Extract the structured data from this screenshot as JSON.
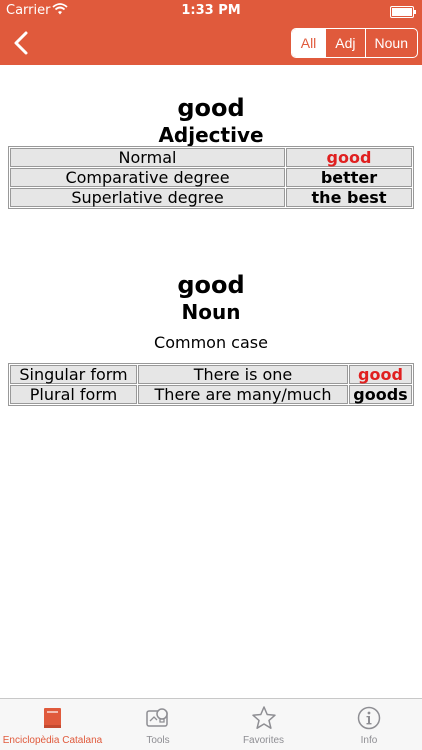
{
  "status_bar": {
    "carrier": "Carrier",
    "time": "1:33 PM"
  },
  "nav": {
    "filters": [
      "All",
      "Adj",
      "Noun"
    ],
    "active_filter": "All"
  },
  "adjective": {
    "word": "good",
    "part_of_speech": "Adjective",
    "rows": [
      {
        "label": "Normal",
        "value": "good"
      },
      {
        "label": "Comparative degree",
        "value": "better"
      },
      {
        "label": "Superlative degree",
        "value": "the best"
      }
    ]
  },
  "noun": {
    "word": "good",
    "part_of_speech": "Noun",
    "case": "Common case",
    "rows": [
      {
        "label": "Singular form",
        "description": "There is one",
        "value": "good"
      },
      {
        "label": "Plural form",
        "description": "There are many/much",
        "value": "goods"
      }
    ]
  },
  "tab_bar": {
    "tabs": [
      {
        "label": "Enciclopèdia Catalana",
        "icon": "book-icon",
        "active": true
      },
      {
        "label": "Tools",
        "icon": "tools-icon",
        "active": false
      },
      {
        "label": "Favorites",
        "icon": "star-icon",
        "active": false
      },
      {
        "label": "Info",
        "icon": "info-icon",
        "active": false
      }
    ]
  },
  "colors": {
    "accent": "#e05a3c",
    "highlight": "#e02020",
    "cell": "#e6e6e6",
    "tab_inactive": "#8e8e93"
  }
}
